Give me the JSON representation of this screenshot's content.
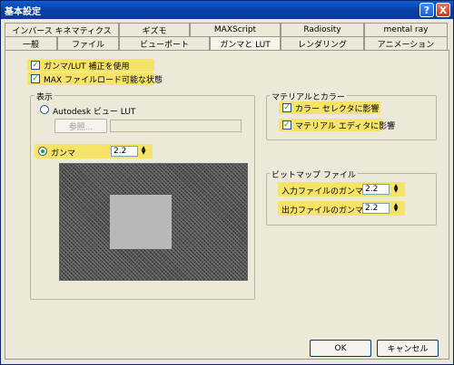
{
  "window": {
    "title": "基本設定",
    "help_glyph": "?",
    "close_glyph": "X"
  },
  "tabs_row1": [
    "インバース キネマティクス",
    "ギズモ",
    "MAXScript",
    "Radiosity",
    "mental ray"
  ],
  "tabs_row2": [
    "一般",
    "ファイル",
    "ビューポート",
    "ガンマと LUT",
    "レンダリング",
    "アニメーション"
  ],
  "active_tab": "ガンマと LUT",
  "options": {
    "enable_gamma": {
      "label": "ガンマ/LUT 補正を使用",
      "checked": true
    },
    "max_file_load": {
      "label": "MAX ファイルロード可能な状態",
      "checked": true
    }
  },
  "display": {
    "title": "表示",
    "autodesk_lut_label": "Autodesk ビュー LUT",
    "browse_label": "参照...",
    "gamma_label": "ガンマ",
    "gamma_value": "2.2",
    "mode": "gamma"
  },
  "material_color": {
    "title": "マテリアルとカラー",
    "color_selector": {
      "label": "カラー セレクタに影響",
      "checked": true
    },
    "material_editor": {
      "label": "マテリアル エディタに影響",
      "checked": true
    }
  },
  "bitmap_files": {
    "title": "ビットマップ ファイル",
    "input_gamma_label": "入力ファイルのガンマ :",
    "input_gamma_value": "2.2",
    "output_gamma_label": "出力ファイルのガンマ :",
    "output_gamma_value": "2.2"
  },
  "buttons": {
    "ok": "OK",
    "cancel": "キャンセル"
  },
  "colors": {
    "highlight": "#f6e36a",
    "titlebar": "#0842a8"
  }
}
